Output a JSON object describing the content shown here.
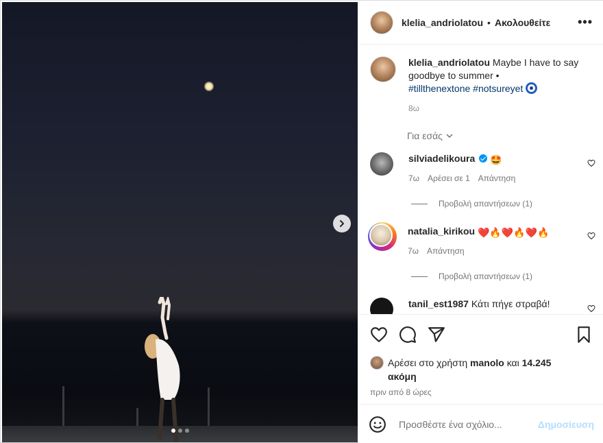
{
  "post": {
    "username": "klelia_andriolatou",
    "separator": "•",
    "follow_state": "Ακολουθείτε",
    "more": "•••",
    "image_alt": "night sea photo with moon",
    "carousel": {
      "count": 3,
      "active": 0
    }
  },
  "caption": {
    "username": "klelia_andriolatou",
    "text": " Maybe I have to say goodbye to summer •",
    "hashtags": "#tillthenextone #notsureyet",
    "age": "8ω"
  },
  "for_you": "Για εσάς",
  "comments": [
    {
      "username": "silviadelikoura",
      "verified": true,
      "text": "🤩",
      "age": "7ω",
      "likes": "Αρέσει σε 1",
      "reply": "Απάντηση",
      "view_replies": "Προβολή απαντήσεων (1)"
    },
    {
      "username": "natalia_kirikou",
      "verified": false,
      "text": "❤️🔥❤️🔥❤️🔥",
      "age": "7ω",
      "reply": "Απάντηση",
      "view_replies": "Προβολή απαντήσεων (1)"
    },
    {
      "username": "tanil_est1987",
      "text": "Κάτι πήγε στραβά!"
    }
  ],
  "likes": {
    "prefix": "Αρέσει στο χρήστη ",
    "user": "manolo",
    "middle": " και ",
    "count": "14.245",
    "suffix": "ακόμη"
  },
  "timestamp": "πριν από 8 ώρες",
  "add_comment": {
    "placeholder": "Προσθέστε ένα σχόλιο...",
    "post_label": "Δημοσίευση"
  },
  "colors": {
    "link": "#00376b",
    "verified": "#0095f6",
    "post_disabled": "#b2dffc"
  },
  "icons": [
    "heart-icon",
    "comment-icon",
    "share-icon",
    "bookmark-icon",
    "emoji-icon",
    "chevron-right-icon",
    "more-icon",
    "chevron-down-icon"
  ]
}
